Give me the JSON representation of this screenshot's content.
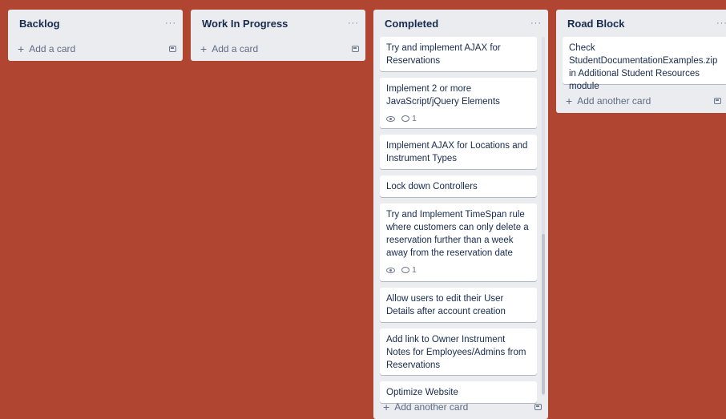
{
  "lists": [
    {
      "title": "Backlog",
      "menu": "···",
      "add_label": "Add a card",
      "cards": []
    },
    {
      "title": "Work In Progress",
      "menu": "···",
      "add_label": "Add a card",
      "cards": []
    },
    {
      "title": "Completed",
      "menu": "···",
      "add_label": "Add another card",
      "cards": [
        {
          "text": "Try and implement AJAX for Reservations"
        },
        {
          "text": "Implement 2 or more JavaScript/jQuery Elements",
          "watch_icon": "eye-icon",
          "comments": "1"
        },
        {
          "text": "Implement AJAX for Locations and Instrument Types"
        },
        {
          "text": "Lock down Controllers"
        },
        {
          "text": "Try and Implement TimeSpan rule where customers can only delete a reservation further than a week away from the reservation date",
          "watch_icon": "eye-icon",
          "comments": "1"
        },
        {
          "text": "Allow users to edit their User Details after account creation"
        },
        {
          "text": "Add link to Owner Instrument Notes for Employees/Admins from Reservations"
        },
        {
          "text": "Optimize Website"
        }
      ]
    },
    {
      "title": "Road Block",
      "menu": "···",
      "add_label": "Add another card",
      "cards": [
        {
          "text": "Check StudentDocumentationExamples.zip in Additional Student Resources module"
        }
      ]
    }
  ],
  "icons": {
    "plus": "+",
    "template": "card-template-icon"
  },
  "colors": {
    "board_background": "#b04632",
    "list_background": "#ebecf0",
    "card_background": "#ffffff"
  }
}
